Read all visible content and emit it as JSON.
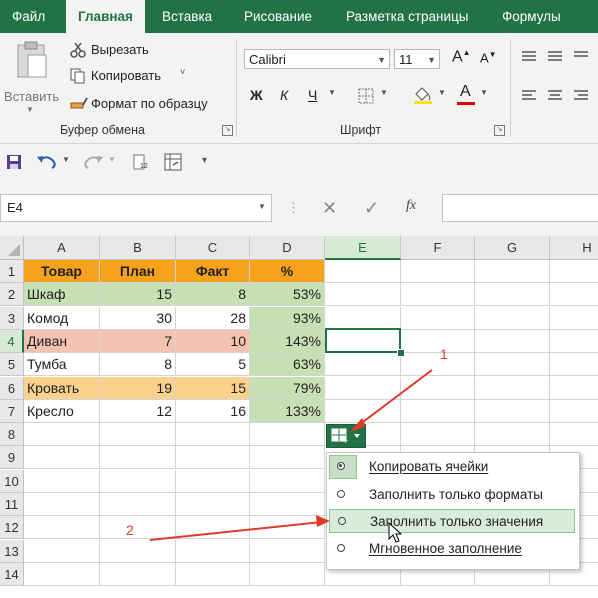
{
  "tabs": [
    "Файл",
    "Главная",
    "Вставка",
    "Рисование",
    "Разметка страницы",
    "Формулы"
  ],
  "clipboard": {
    "paste": "Вставить",
    "cut": "Вырезать",
    "copy": "Копировать",
    "format_painter": "Формат по образцу",
    "group": "Буфер обмена"
  },
  "font": {
    "name": "Calibri",
    "size": "11",
    "bold": "Ж",
    "italic": "К",
    "underline": "Ч",
    "group": "Шрифт"
  },
  "namebox": "E4",
  "fx": "fx",
  "columns": [
    "A",
    "B",
    "C",
    "D",
    "E",
    "F",
    "G",
    "H"
  ],
  "rows": [
    "1",
    "2",
    "3",
    "4",
    "5",
    "6",
    "7",
    "8",
    "9",
    "10",
    "11",
    "12",
    "13",
    "14"
  ],
  "table": {
    "headers": [
      "Товар",
      "План",
      "Факт",
      "%"
    ],
    "rows": [
      [
        "Шкаф",
        "15",
        "8",
        "53%"
      ],
      [
        "Комод",
        "30",
        "28",
        "93%"
      ],
      [
        "Диван",
        "7",
        "10",
        "143%"
      ],
      [
        "Тумба",
        "8",
        "5",
        "63%"
      ],
      [
        "Кровать",
        "19",
        "15",
        "79%"
      ],
      [
        "Кресло",
        "12",
        "16",
        "133%"
      ]
    ]
  },
  "autofill_menu": [
    "Копировать ячейки",
    "Заполнить только форматы",
    "Заполнить только значения",
    "Мгновенное заполнение"
  ],
  "annotations": [
    "1",
    "2"
  ],
  "colors": {
    "excel_green": "#217346",
    "header_orange": "#f7a21b",
    "row_green": "#c6e0b4",
    "row_pink": "#f4c2b0",
    "row_orange": "#fcd18b",
    "pct_green": "#c6e0b4",
    "arrow_red": "#e03a2a"
  }
}
